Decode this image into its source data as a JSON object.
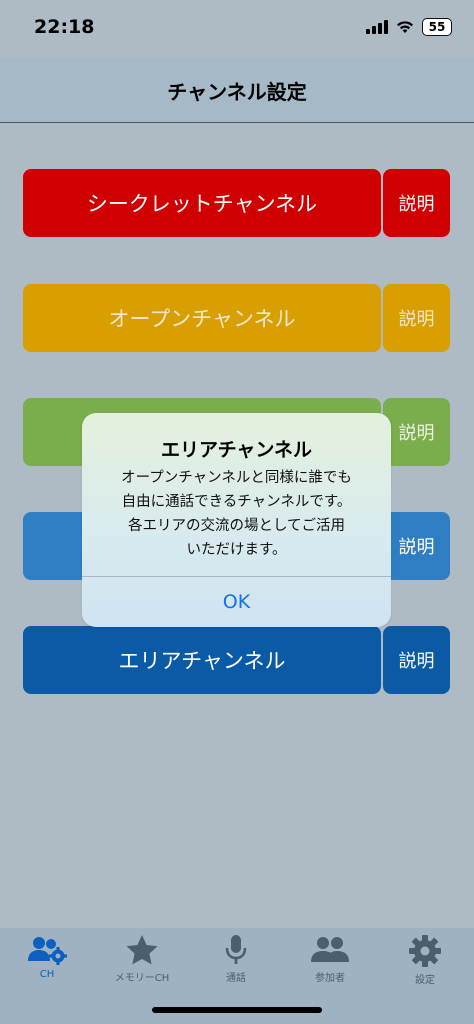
{
  "status_bar": {
    "time": "22:18",
    "battery": "55"
  },
  "nav": {
    "title": "チャンネル設定"
  },
  "channels": [
    {
      "label": "シークレットチャンネル",
      "desc": "説明",
      "color": "#d00000"
    },
    {
      "label": "オープンチャンネル",
      "desc": "説明",
      "color": "#d99f00"
    },
    {
      "label": "",
      "desc": "説明",
      "color": "#7aad4b"
    },
    {
      "label": "",
      "desc": "説明",
      "color": "#2f7ec4"
    },
    {
      "label": "エリアチャンネル",
      "desc": "説明",
      "color": "#0b5aa6"
    }
  ],
  "alert": {
    "title": "エリアチャンネル",
    "message_lines": [
      "オープンチャンネルと同様に誰でも",
      "自由に通話できるチャンネルです。",
      "各エリアの交流の場としてご活用",
      "いただけます。"
    ],
    "ok": "OK"
  },
  "tabs": [
    {
      "label": "CH",
      "icon": "users-gear-icon",
      "active": true
    },
    {
      "label": "メモリーCH",
      "icon": "star-icon",
      "active": false
    },
    {
      "label": "通話",
      "icon": "microphone-icon",
      "active": false
    },
    {
      "label": "参加者",
      "icon": "users-icon",
      "active": false
    },
    {
      "label": "設定",
      "icon": "gear-icon",
      "active": false
    }
  ],
  "colors": {
    "active_tab": "#0d5fc0",
    "inactive_tab": "#4c5e6b",
    "alert_ok": "#1472e6"
  }
}
